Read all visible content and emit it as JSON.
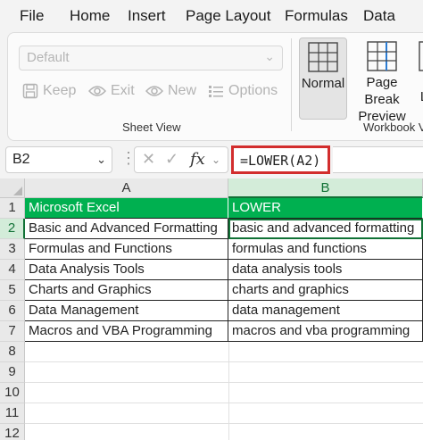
{
  "tabs": [
    "File",
    "Home",
    "Insert",
    "Page Layout",
    "Formulas",
    "Data"
  ],
  "sheet_view": {
    "select_value": "Default",
    "buttons": [
      "Keep",
      "Exit",
      "New",
      "Options"
    ],
    "group_label": "Sheet View"
  },
  "workbook_views": {
    "normal": "Normal",
    "page_break_line1": "Page Break",
    "page_break_line2": "Preview",
    "partial": "L",
    "group_label": "Workbook V"
  },
  "formula_bar": {
    "name_box": "B2",
    "fx": "fx",
    "formula": "=LOWER(A2)"
  },
  "columns": [
    "A",
    "B"
  ],
  "rows": [
    "1",
    "2",
    "3",
    "4",
    "5",
    "6",
    "7",
    "8",
    "9",
    "10",
    "11",
    "12"
  ],
  "table": {
    "headers": [
      "Microsoft Excel",
      "LOWER"
    ],
    "data": [
      [
        "Basic and Advanced Formatting",
        "basic and advanced formatting"
      ],
      [
        "Formulas and Functions",
        "formulas and functions"
      ],
      [
        "Data Analysis Tools",
        "data analysis tools"
      ],
      [
        "Charts and Graphics",
        "charts and graphics"
      ],
      [
        "Data Management",
        "data management"
      ],
      [
        "Macros and VBA Programming",
        "macros and vba programming"
      ]
    ]
  },
  "colors": {
    "header_fill": "#00b050",
    "accent_green": "#117236",
    "highlight_red": "#d22d2d"
  }
}
